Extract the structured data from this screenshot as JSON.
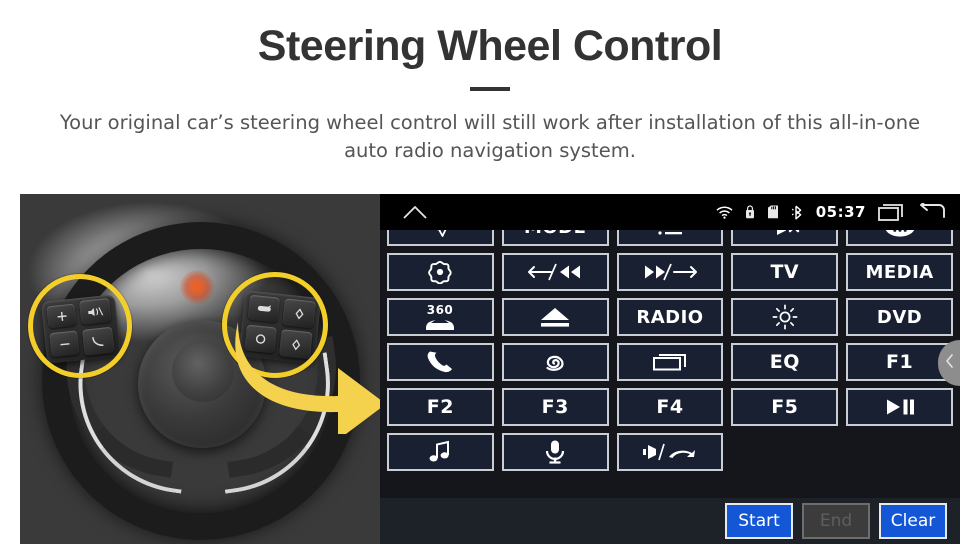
{
  "header": {
    "title": "Steering Wheel Control",
    "subtitle": "Your original car’s steering wheel control will still work after installation of this all-in-one auto radio navigation system."
  },
  "photo": {
    "alt": "Car steering wheel with highlighted left and right control pods",
    "highlight_color": "#f4cf2a",
    "arrow_color": "#f5d24e",
    "left_pod_keys": [
      "volume-up",
      "mute",
      "volume-down",
      "phone-answer"
    ],
    "right_pod_keys": [
      "source",
      "up-arrow",
      "ok",
      "down-arrow"
    ]
  },
  "radio": {
    "statusbar": {
      "home_icon": "home-icon",
      "wifi_icon": "wifi-icon",
      "lock_icon": "lock-icon",
      "sdcard_icon": "sdcard-icon",
      "bluetooth_icon": "bluetooth-icon",
      "time": "05:37",
      "recents_icon": "recents-icon",
      "back_icon": "back-icon"
    },
    "drawer_handle_icon": "chevron-left-icon",
    "buttons": [
      {
        "id": "nav",
        "label": "",
        "icon": "navigation-arrow-icon"
      },
      {
        "id": "mode",
        "label": "MODE",
        "icon": ""
      },
      {
        "id": "list",
        "label": "",
        "icon": "list-icon"
      },
      {
        "id": "mute",
        "label": "",
        "icon": "mute-icon"
      },
      {
        "id": "apps",
        "label": "",
        "icon": "apps-grid-icon"
      },
      {
        "id": "setting",
        "label": "",
        "icon": "target-icon"
      },
      {
        "id": "prev",
        "label": "",
        "icon": "previous-track-icon"
      },
      {
        "id": "next",
        "label": "",
        "icon": "next-track-icon"
      },
      {
        "id": "tv",
        "label": "TV",
        "icon": ""
      },
      {
        "id": "media",
        "label": "MEDIA",
        "icon": ""
      },
      {
        "id": "cam360",
        "label": "360",
        "icon": "car-360-icon"
      },
      {
        "id": "eject",
        "label": "",
        "icon": "eject-icon"
      },
      {
        "id": "radio",
        "label": "RADIO",
        "icon": ""
      },
      {
        "id": "bright",
        "label": "",
        "icon": "brightness-icon"
      },
      {
        "id": "dvd",
        "label": "DVD",
        "icon": ""
      },
      {
        "id": "phone",
        "label": "",
        "icon": "phone-icon"
      },
      {
        "id": "swirl",
        "label": "",
        "icon": "spiral-icon"
      },
      {
        "id": "screen",
        "label": "",
        "icon": "screen-icon"
      },
      {
        "id": "eq",
        "label": "EQ",
        "icon": ""
      },
      {
        "id": "f1",
        "label": "F1",
        "icon": ""
      },
      {
        "id": "f2",
        "label": "F2",
        "icon": ""
      },
      {
        "id": "f3",
        "label": "F3",
        "icon": ""
      },
      {
        "id": "f4",
        "label": "F4",
        "icon": ""
      },
      {
        "id": "f5",
        "label": "F5",
        "icon": ""
      },
      {
        "id": "playpause",
        "label": "",
        "icon": "play-pause-icon"
      },
      {
        "id": "music",
        "label": "",
        "icon": "music-note-icon"
      },
      {
        "id": "mic",
        "label": "",
        "icon": "microphone-icon"
      },
      {
        "id": "volhang",
        "label": "",
        "icon": "volume-hangup-icon"
      }
    ],
    "footer": {
      "start_label": "Start",
      "end_label": "End",
      "clear_label": "Clear",
      "accent_color": "#1356d6"
    }
  }
}
